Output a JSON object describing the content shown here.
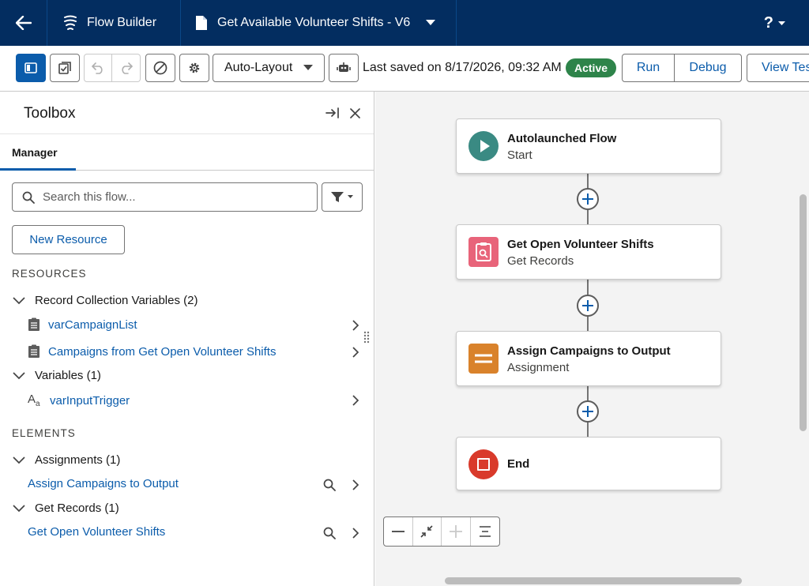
{
  "topbar": {
    "app_name": "Flow Builder",
    "flow_name": "Get Available Volunteer Shifts - V6",
    "help_label": "?"
  },
  "toolbar": {
    "layout_select": "Auto-Layout",
    "last_saved": "Last saved on 8/17/2026, 09:32 AM",
    "status_badge": "Active",
    "run_label": "Run",
    "debug_label": "Debug",
    "view_tests_label": "View Tes"
  },
  "sidebar": {
    "title": "Toolbox",
    "tab": "Manager",
    "search_placeholder": "Search this flow...",
    "new_resource": "New Resource",
    "resources_heading": "RESOURCES",
    "resources": [
      {
        "label": "Record Collection Variables (2)",
        "items": [
          "varCampaignList",
          "Campaigns from Get Open Volunteer Shifts"
        ]
      },
      {
        "label": "Variables (1)",
        "items": [
          "varInputTrigger"
        ]
      }
    ],
    "elements_heading": "ELEMENTS",
    "elements": [
      {
        "label": "Assignments (1)",
        "items": [
          "Assign Campaigns to Output"
        ]
      },
      {
        "label": "Get Records (1)",
        "items": [
          "Get Open Volunteer Shifts"
        ]
      }
    ]
  },
  "canvas": {
    "nodes": [
      {
        "title": "Autolaunched Flow",
        "subtitle": "Start",
        "color": "#3a8a83"
      },
      {
        "title": "Get Open Volunteer Shifts",
        "subtitle": "Get Records",
        "color": "#e8647a"
      },
      {
        "title": "Assign Campaigns to Output",
        "subtitle": "Assignment",
        "color": "#d9822b"
      },
      {
        "title": "End",
        "subtitle": "",
        "color": "#d93a2b"
      }
    ]
  },
  "colors": {
    "header_bg": "#032d60",
    "brand_blue": "#0b5cab",
    "active_green": "#2e844a"
  }
}
